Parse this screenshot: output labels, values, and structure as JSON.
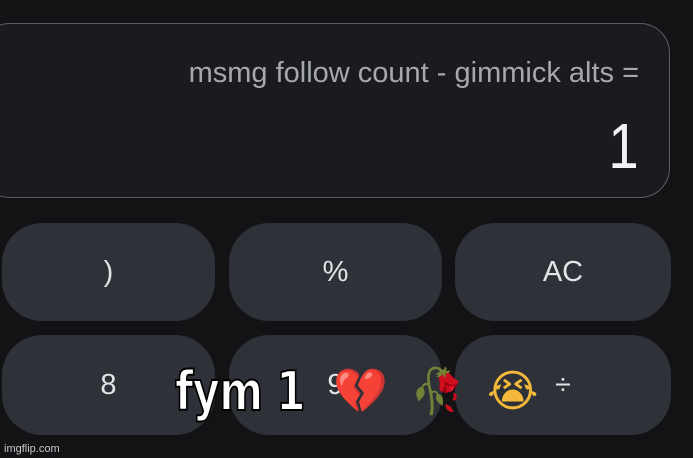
{
  "display": {
    "expression": "msmg follow count - gimmick alts =",
    "result": "1"
  },
  "keys": {
    "row1": [
      "",
      ")",
      "%",
      "AC"
    ],
    "row2": [
      "",
      "8",
      "9",
      "÷"
    ]
  },
  "caption": {
    "text": "fym 1",
    "emojis": [
      "💔",
      "🥀",
      "😭"
    ]
  },
  "watermark": "imgflip.com"
}
